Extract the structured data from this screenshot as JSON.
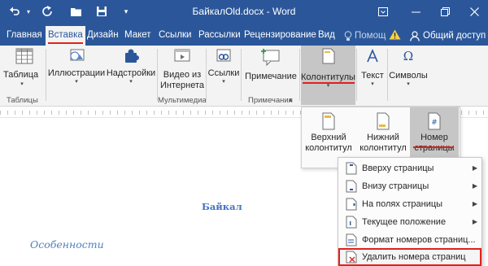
{
  "titlebar": {
    "title": "БайкалOld.docx - Word",
    "quick_access": [
      "undo",
      "redo",
      "open",
      "save",
      "customize"
    ],
    "window_controls": [
      "ribbon-display",
      "minimize",
      "restore",
      "close"
    ],
    "bg_color": "#2b579a"
  },
  "tabs": {
    "items": [
      "Главная",
      "Вставка",
      "Дизайн",
      "Макет",
      "Ссылки",
      "Рассылки",
      "Рецензирование",
      "Вид"
    ],
    "active": "Вставка",
    "help_label": "Помощ",
    "share_label": "Общий доступ"
  },
  "ribbon": {
    "buttons": {
      "table": "Таблица",
      "illustrations": "Иллюстрации",
      "addins": "Надстройки",
      "online_video": "Видео из Интернета",
      "links": "Ссылки",
      "comment": "Примечание",
      "header_footer": "Колонтитулы",
      "text": "Текст",
      "symbols": "Символы"
    },
    "groups": {
      "tables": "Таблицы",
      "media": "Мультимедиа",
      "comments": "Примечания"
    }
  },
  "header_footer_panel": {
    "header": "Верхний колонтитул",
    "footer": "Нижний колонтитул",
    "page_number": "Номер страницы"
  },
  "page_number_menu": {
    "items": [
      {
        "label": "Вверху страницы",
        "has_submenu": true
      },
      {
        "label": "Внизу страницы",
        "has_submenu": true
      },
      {
        "label": "На полях страницы",
        "has_submenu": true
      },
      {
        "label": "Текущее положение",
        "has_submenu": true
      },
      {
        "label": "Формат номеров страниц...",
        "has_submenu": false
      },
      {
        "label": "Удалить номера страниц",
        "has_submenu": false,
        "highlighted": true
      }
    ]
  },
  "document": {
    "heading": "Байкал",
    "subheading": "Особенности"
  },
  "colors": {
    "accent": "#2b579a",
    "highlight": "#e0211b",
    "selected_button": "#c6c6c6"
  }
}
